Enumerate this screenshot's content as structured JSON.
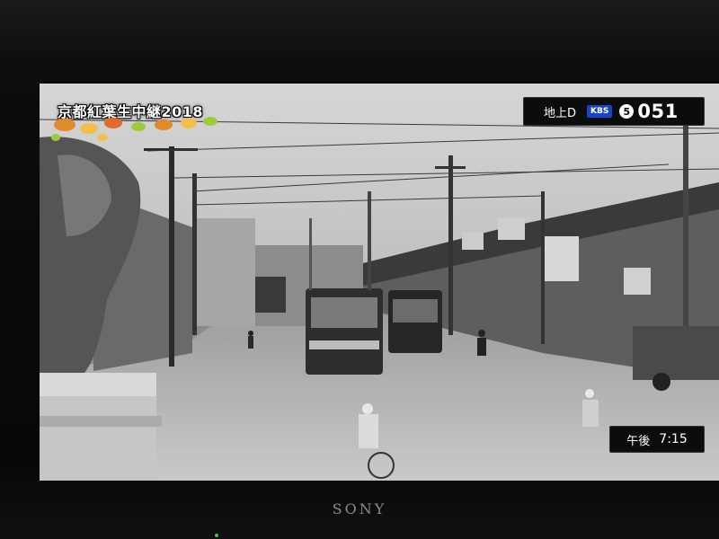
{
  "overlay": {
    "program_title": "京都紅葉生中継2018"
  },
  "channel": {
    "band_label": "地上D",
    "network_badge": "KBS",
    "number_icon": "5",
    "number": "051"
  },
  "clock": {
    "period": "午後",
    "time": "7:15"
  },
  "tv": {
    "brand": "SONY"
  },
  "icons": {
    "leaves": "autumn-leaves-decoration",
    "channel": "channel-circle-icon"
  },
  "colors": {
    "badge_blue": "#1646c8",
    "leaf_orange": "#e08a2a",
    "leaf_green": "#9ccc3a",
    "power_led": "#29d04a"
  }
}
